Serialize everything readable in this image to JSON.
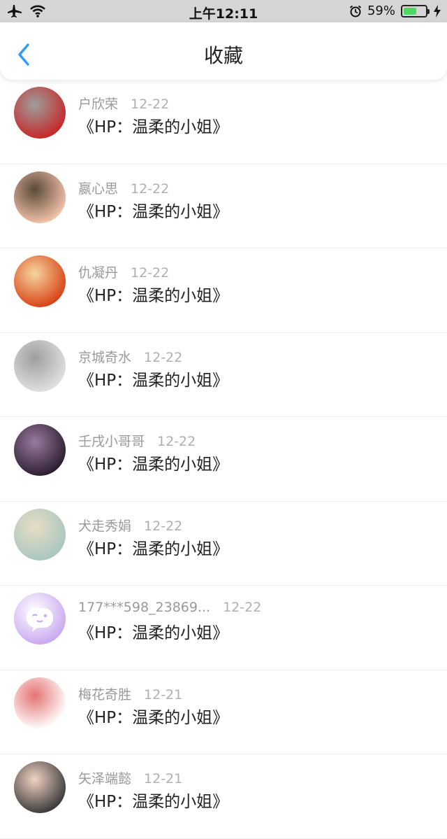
{
  "status_bar": {
    "time": "上午12:11",
    "battery_percent": "59%",
    "battery_level": 0.59,
    "icons": [
      "airplane-icon",
      "wifi-icon",
      "alarm-icon",
      "battery-icon",
      "charging-icon"
    ]
  },
  "nav": {
    "title": "收藏",
    "back_icon": "chevron-left-icon",
    "accent_color": "#2a9df4"
  },
  "favorites": [
    {
      "user": "户欣荣",
      "date": "12-22",
      "title": "《HP：温柔的小姐》",
      "avatar_colors": [
        "#c62828",
        "#9e9e9e"
      ]
    },
    {
      "user": "嬴心思",
      "date": "12-22",
      "title": "《HP：温柔的小姐》",
      "avatar_colors": [
        "#f3c1a8",
        "#5a4a3a"
      ]
    },
    {
      "user": "仇凝丹",
      "date": "12-22",
      "title": "《HP：温柔的小姐》",
      "avatar_colors": [
        "#d84315",
        "#f5d6a0"
      ]
    },
    {
      "user": "京城奇水",
      "date": "12-22",
      "title": "《HP：温柔的小姐》",
      "avatar_colors": [
        "#e0e0e0",
        "#9e9e9e"
      ]
    },
    {
      "user": "壬戌小哥哥",
      "date": "12-22",
      "title": "《HP：温柔的小姐》",
      "avatar_colors": [
        "#2b1f2f",
        "#9a7aa0"
      ]
    },
    {
      "user": "犬走秀娟",
      "date": "12-22",
      "title": "《HP：温柔的小姐》",
      "avatar_colors": [
        "#a9c7c0",
        "#e8ddc4"
      ]
    },
    {
      "user": "177***598_23869...",
      "date": "12-22",
      "title": "《HP：温柔的小姐》",
      "avatar_colors": [
        "#c9a9f0",
        "#ffffff"
      ]
    },
    {
      "user": "梅花奇胜",
      "date": "12-21",
      "title": "《HP：温柔的小姐》",
      "avatar_colors": [
        "#ffffff",
        "#e57373"
      ]
    },
    {
      "user": "矢泽端懿",
      "date": "12-21",
      "title": "《HP：温柔的小姐》",
      "avatar_colors": [
        "#3b3b3b",
        "#f2d2c2"
      ]
    }
  ]
}
